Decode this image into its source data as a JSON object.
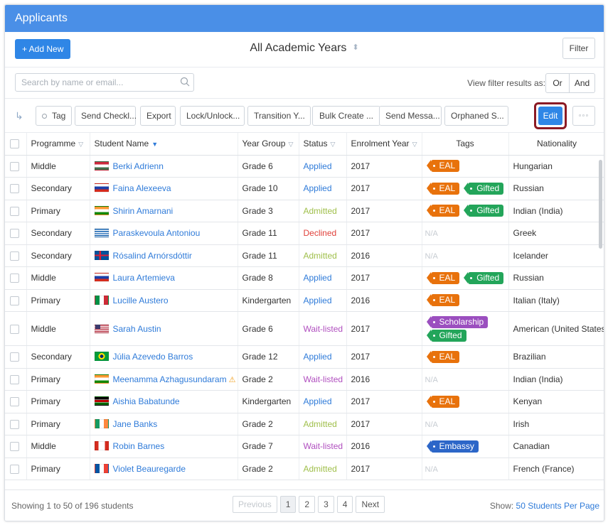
{
  "title": "Applicants",
  "header": {
    "add_label": "+ Add New",
    "academic_years": "All Academic Years",
    "filter_label": "Filter"
  },
  "search": {
    "placeholder": "Search by name or email...",
    "value": ""
  },
  "view_filter": {
    "label": "View filter results as:",
    "or": "Or",
    "and": "And"
  },
  "toolbar": {
    "buttons": [
      "Tag",
      "Send Checkl...",
      "Export",
      "Lock/Unlock...",
      "Transition Y...",
      "Bulk Create ...",
      "Send Messa...",
      "Orphaned S..."
    ],
    "edit_label": "Edit",
    "more_label": "◦◦◦"
  },
  "columns": [
    "Programme",
    "Student Name",
    "Year Group",
    "Status",
    "Enrolment Year",
    "Tags",
    "Nationality"
  ],
  "rows": [
    {
      "programme": "Middle",
      "name": "Berki Adrienn",
      "flag": "hu",
      "year_group": "Grade 6",
      "status": "Applied",
      "enrol": "2017",
      "tags": [
        "EAL"
      ],
      "nationality": "Hungarian"
    },
    {
      "programme": "Secondary",
      "name": "Faina Alexeeva",
      "flag": "ru",
      "year_group": "Grade 10",
      "status": "Applied",
      "enrol": "2017",
      "tags": [
        "EAL",
        "Gifted"
      ],
      "nationality": "Russian"
    },
    {
      "programme": "Primary",
      "name": "Shirin Amarnani",
      "flag": "in",
      "year_group": "Grade 3",
      "status": "Admitted",
      "enrol": "2017",
      "tags": [
        "EAL",
        "Gifted"
      ],
      "nationality": "Indian (India)"
    },
    {
      "programme": "Secondary",
      "name": "Paraskevoula Antoniou",
      "flag": "gr",
      "year_group": "Grade 11",
      "status": "Declined",
      "enrol": "2017",
      "tags": [],
      "nationality": "Greek"
    },
    {
      "programme": "Secondary",
      "name": "Rósalind Arnórsdóttir",
      "flag": "is",
      "year_group": "Grade 11",
      "status": "Admitted",
      "enrol": "2016",
      "tags": [],
      "nationality": "Icelander"
    },
    {
      "programme": "Middle",
      "name": "Laura Artemieva",
      "flag": "ru",
      "year_group": "Grade 8",
      "status": "Applied",
      "enrol": "2017",
      "tags": [
        "EAL",
        "Gifted"
      ],
      "nationality": "Russian"
    },
    {
      "programme": "Primary",
      "name": "Lucille Austero",
      "flag": "it",
      "year_group": "Kindergarten",
      "status": "Applied",
      "enrol": "2016",
      "tags": [
        "EAL"
      ],
      "nationality": "Italian (Italy)"
    },
    {
      "programme": "Middle",
      "name": "Sarah Austin",
      "flag": "us",
      "year_group": "Grade 6",
      "status": "Wait-listed",
      "enrol": "2017",
      "tags": [
        "Scholarship",
        "Gifted"
      ],
      "stack": true,
      "nationality": "American (United States)"
    },
    {
      "programme": "Secondary",
      "name": "Júlia Azevedo Barros",
      "flag": "br",
      "year_group": "Grade 12",
      "status": "Applied",
      "enrol": "2017",
      "tags": [
        "EAL"
      ],
      "nationality": "Brazilian"
    },
    {
      "programme": "Primary",
      "name": "Meenamma Azhagusundaram",
      "flag": "in",
      "warn": true,
      "year_group": "Grade 2",
      "status": "Wait-listed",
      "enrol": "2016",
      "tags": [],
      "nationality": "Indian (India)"
    },
    {
      "programme": "Primary",
      "name": "Aishia Babatunde",
      "flag": "ke",
      "year_group": "Kindergarten",
      "status": "Applied",
      "enrol": "2017",
      "tags": [
        "EAL"
      ],
      "nationality": "Kenyan"
    },
    {
      "programme": "Primary",
      "name": "Jane Banks",
      "flag": "ie",
      "year_group": "Grade 2",
      "status": "Admitted",
      "enrol": "2017",
      "tags": [],
      "nationality": "Irish"
    },
    {
      "programme": "Middle",
      "name": "Robin Barnes",
      "flag": "ca",
      "year_group": "Grade 7",
      "status": "Wait-listed",
      "enrol": "2016",
      "tags": [
        "Embassy"
      ],
      "nationality": "Canadian"
    },
    {
      "programme": "Primary",
      "name": "Violet Beauregarde",
      "flag": "fr",
      "year_group": "Grade 2",
      "status": "Admitted",
      "enrol": "2017",
      "tags": [],
      "nationality": "French (France)"
    }
  ],
  "na_text": "N/A",
  "footer": {
    "showing": "Showing 1 to 50 of 196 students",
    "previous": "Previous",
    "pages": [
      "1",
      "2",
      "3",
      "4"
    ],
    "next": "Next",
    "show_label": "Show:",
    "per_page_value": "50 Students",
    "per_page_suffix": "Per Page"
  },
  "colors": {
    "header": "#4a8fe7",
    "primary_button": "#2f86e6",
    "edit_highlight": "#8b1a24",
    "EAL": "#e8720c",
    "Gifted": "#23a55a",
    "Scholarship": "#9b4fbf",
    "Embassy": "#2c66c8"
  }
}
